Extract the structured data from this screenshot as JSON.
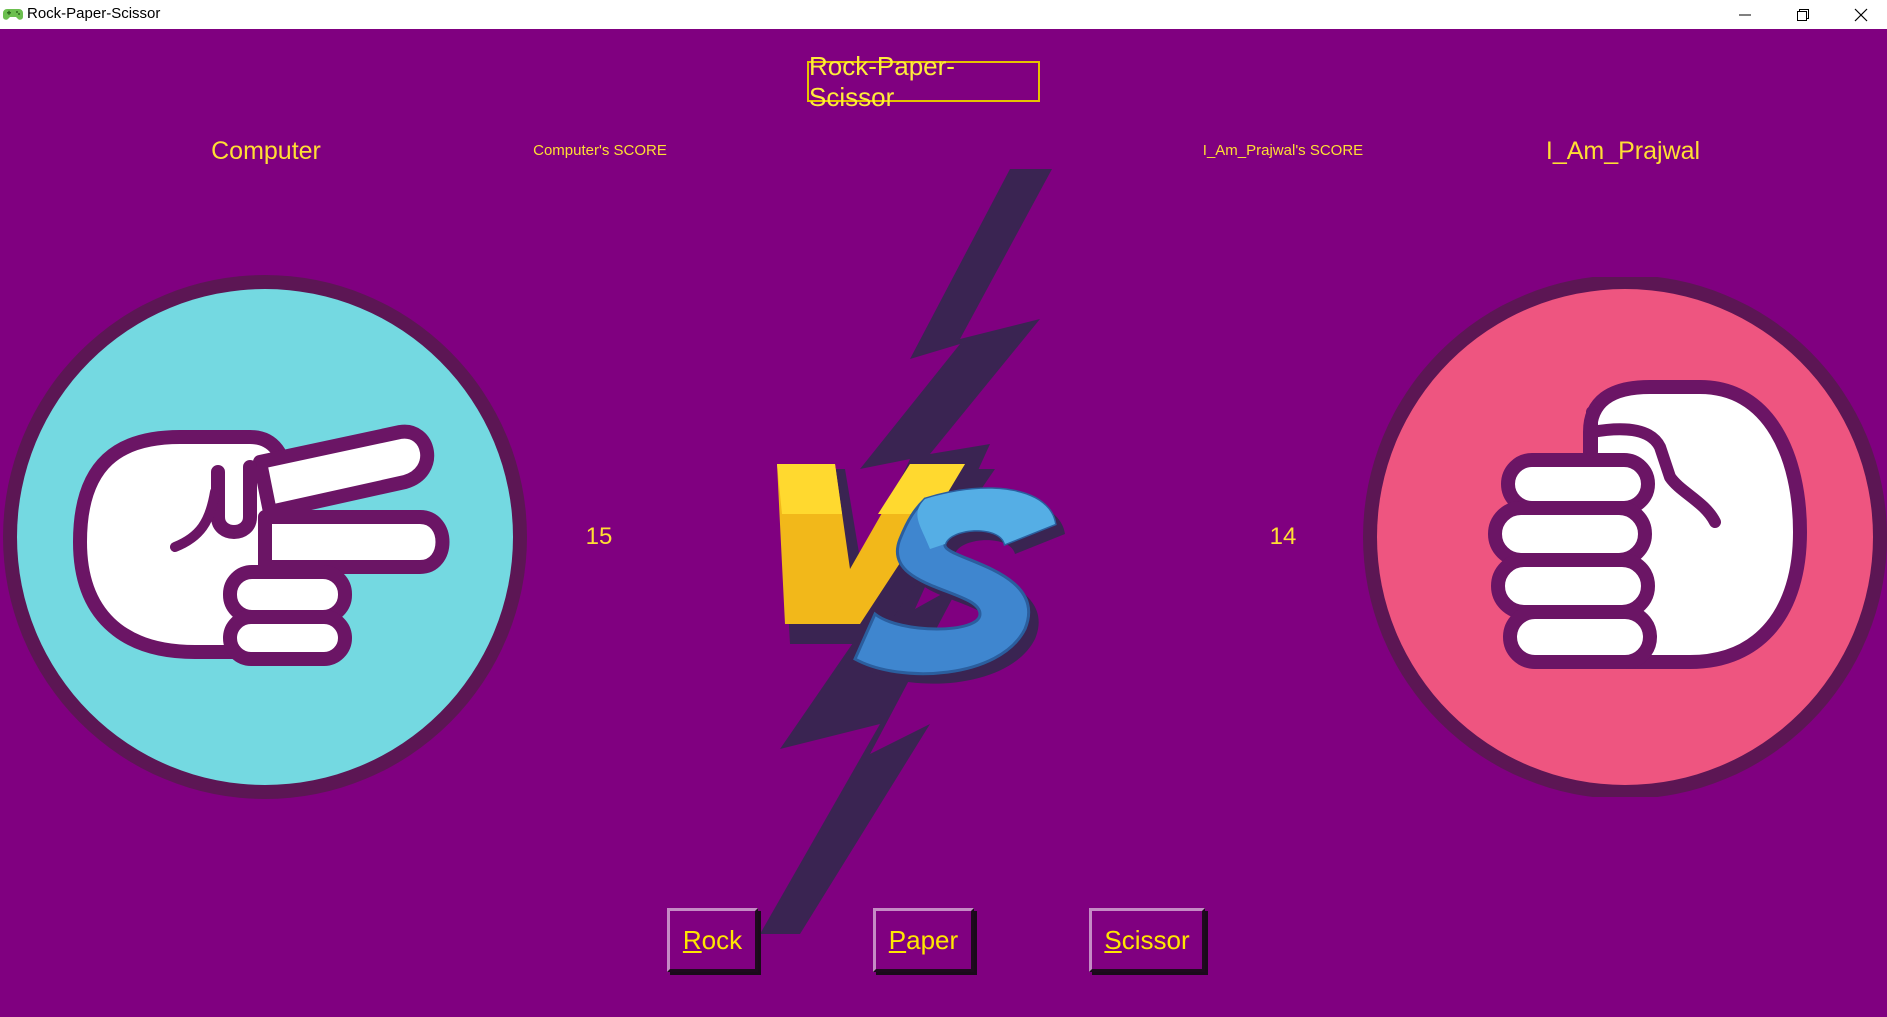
{
  "window": {
    "title": "Rock-Paper-Scissor",
    "icon": "gamepad-icon",
    "controls": [
      "minimize-icon",
      "restore-icon",
      "close-icon"
    ]
  },
  "game": {
    "heading": "Rock-Paper-Scissor",
    "computer": {
      "name": "Computer",
      "score_label": "Computer's SCORE",
      "score": "15",
      "choice_icon": "scissors-hand-icon"
    },
    "user": {
      "name": "I_Am_Prajwal",
      "score_label": "I_Am_Prajwal's SCORE",
      "score": "14",
      "choice_icon": "rock-fist-hand-icon"
    },
    "vs_graphic": "versus-lightning-icon",
    "buttons": {
      "rock": {
        "first": "R",
        "rest": "ock"
      },
      "paper": {
        "first": "P",
        "rest": "aper"
      },
      "scissor": {
        "first": "S",
        "rest": "cissor"
      }
    }
  },
  "colors": {
    "background": "#800080",
    "text": "#ffdf33",
    "computer_circle": "#74d9e1",
    "user_circle": "#ee5580",
    "circle_ring": "#5c1654",
    "hand_outline": "#6b1565"
  }
}
